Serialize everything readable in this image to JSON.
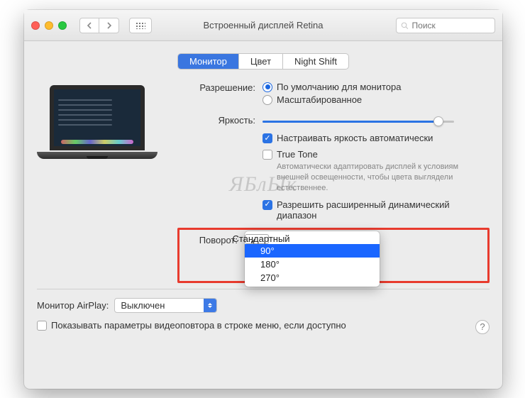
{
  "window": {
    "title": "Встроенный дисплей Retina",
    "search_placeholder": "Поиск"
  },
  "tabs": [
    "Монитор",
    "Цвет",
    "Night Shift"
  ],
  "form": {
    "resolution_label": "Разрешение:",
    "resolution_options": {
      "default": "По умолчанию для монитора",
      "scaled": "Масштабированное"
    },
    "brightness_label": "Яркость:",
    "auto_brightness": "Настраивать яркость автоматически",
    "truetone": "True Tone",
    "truetone_note": "Автоматически адаптировать дисплей к условиям внешней освещенности, чтобы цвета выглядели естественнее.",
    "hdr": "Разрешить расширенный динамический диапазон",
    "rotation_label": "Поворот:",
    "rotation_options": [
      "Стандартный",
      "90°",
      "180°",
      "270°"
    ]
  },
  "bottom": {
    "airplay_label": "Монитор AirPlay:",
    "airplay_value": "Выключен",
    "mirror_opt": "Показывать параметры видеоповтора в строке меню, если доступно"
  },
  "watermark": "ЯБлЫк"
}
